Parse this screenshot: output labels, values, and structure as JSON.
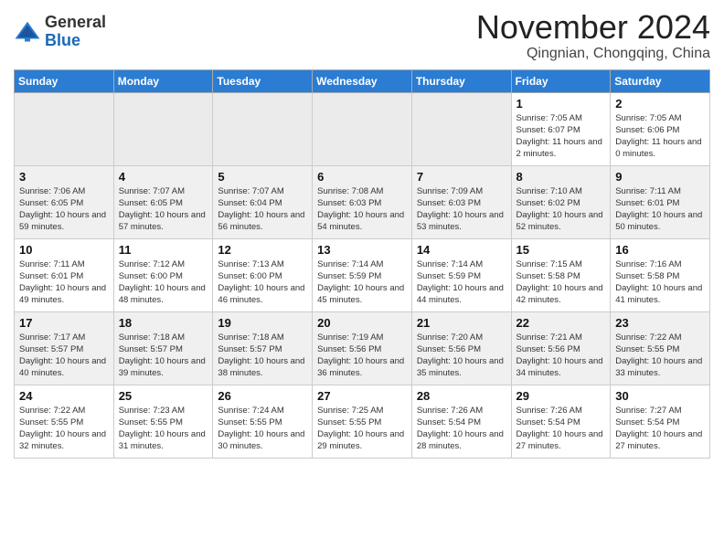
{
  "header": {
    "logo_general": "General",
    "logo_blue": "Blue",
    "month_title": "November 2024",
    "subtitle": "Qingnian, Chongqing, China"
  },
  "weekdays": [
    "Sunday",
    "Monday",
    "Tuesday",
    "Wednesday",
    "Thursday",
    "Friday",
    "Saturday"
  ],
  "weeks": [
    [
      {
        "day": "",
        "empty": true
      },
      {
        "day": "",
        "empty": true
      },
      {
        "day": "",
        "empty": true
      },
      {
        "day": "",
        "empty": true
      },
      {
        "day": "",
        "empty": true
      },
      {
        "day": "1",
        "sunrise": "7:05 AM",
        "sunset": "6:07 PM",
        "daylight": "11 hours and 2 minutes."
      },
      {
        "day": "2",
        "sunrise": "7:05 AM",
        "sunset": "6:06 PM",
        "daylight": "11 hours and 0 minutes."
      }
    ],
    [
      {
        "day": "3",
        "sunrise": "7:06 AM",
        "sunset": "6:05 PM",
        "daylight": "10 hours and 59 minutes."
      },
      {
        "day": "4",
        "sunrise": "7:07 AM",
        "sunset": "6:05 PM",
        "daylight": "10 hours and 57 minutes."
      },
      {
        "day": "5",
        "sunrise": "7:07 AM",
        "sunset": "6:04 PM",
        "daylight": "10 hours and 56 minutes."
      },
      {
        "day": "6",
        "sunrise": "7:08 AM",
        "sunset": "6:03 PM",
        "daylight": "10 hours and 54 minutes."
      },
      {
        "day": "7",
        "sunrise": "7:09 AM",
        "sunset": "6:03 PM",
        "daylight": "10 hours and 53 minutes."
      },
      {
        "day": "8",
        "sunrise": "7:10 AM",
        "sunset": "6:02 PM",
        "daylight": "10 hours and 52 minutes."
      },
      {
        "day": "9",
        "sunrise": "7:11 AM",
        "sunset": "6:01 PM",
        "daylight": "10 hours and 50 minutes."
      }
    ],
    [
      {
        "day": "10",
        "sunrise": "7:11 AM",
        "sunset": "6:01 PM",
        "daylight": "10 hours and 49 minutes."
      },
      {
        "day": "11",
        "sunrise": "7:12 AM",
        "sunset": "6:00 PM",
        "daylight": "10 hours and 48 minutes."
      },
      {
        "day": "12",
        "sunrise": "7:13 AM",
        "sunset": "6:00 PM",
        "daylight": "10 hours and 46 minutes."
      },
      {
        "day": "13",
        "sunrise": "7:14 AM",
        "sunset": "5:59 PM",
        "daylight": "10 hours and 45 minutes."
      },
      {
        "day": "14",
        "sunrise": "7:14 AM",
        "sunset": "5:59 PM",
        "daylight": "10 hours and 44 minutes."
      },
      {
        "day": "15",
        "sunrise": "7:15 AM",
        "sunset": "5:58 PM",
        "daylight": "10 hours and 42 minutes."
      },
      {
        "day": "16",
        "sunrise": "7:16 AM",
        "sunset": "5:58 PM",
        "daylight": "10 hours and 41 minutes."
      }
    ],
    [
      {
        "day": "17",
        "sunrise": "7:17 AM",
        "sunset": "5:57 PM",
        "daylight": "10 hours and 40 minutes."
      },
      {
        "day": "18",
        "sunrise": "7:18 AM",
        "sunset": "5:57 PM",
        "daylight": "10 hours and 39 minutes."
      },
      {
        "day": "19",
        "sunrise": "7:18 AM",
        "sunset": "5:57 PM",
        "daylight": "10 hours and 38 minutes."
      },
      {
        "day": "20",
        "sunrise": "7:19 AM",
        "sunset": "5:56 PM",
        "daylight": "10 hours and 36 minutes."
      },
      {
        "day": "21",
        "sunrise": "7:20 AM",
        "sunset": "5:56 PM",
        "daylight": "10 hours and 35 minutes."
      },
      {
        "day": "22",
        "sunrise": "7:21 AM",
        "sunset": "5:56 PM",
        "daylight": "10 hours and 34 minutes."
      },
      {
        "day": "23",
        "sunrise": "7:22 AM",
        "sunset": "5:55 PM",
        "daylight": "10 hours and 33 minutes."
      }
    ],
    [
      {
        "day": "24",
        "sunrise": "7:22 AM",
        "sunset": "5:55 PM",
        "daylight": "10 hours and 32 minutes."
      },
      {
        "day": "25",
        "sunrise": "7:23 AM",
        "sunset": "5:55 PM",
        "daylight": "10 hours and 31 minutes."
      },
      {
        "day": "26",
        "sunrise": "7:24 AM",
        "sunset": "5:55 PM",
        "daylight": "10 hours and 30 minutes."
      },
      {
        "day": "27",
        "sunrise": "7:25 AM",
        "sunset": "5:55 PM",
        "daylight": "10 hours and 29 minutes."
      },
      {
        "day": "28",
        "sunrise": "7:26 AM",
        "sunset": "5:54 PM",
        "daylight": "10 hours and 28 minutes."
      },
      {
        "day": "29",
        "sunrise": "7:26 AM",
        "sunset": "5:54 PM",
        "daylight": "10 hours and 27 minutes."
      },
      {
        "day": "30",
        "sunrise": "7:27 AM",
        "sunset": "5:54 PM",
        "daylight": "10 hours and 27 minutes."
      }
    ]
  ]
}
